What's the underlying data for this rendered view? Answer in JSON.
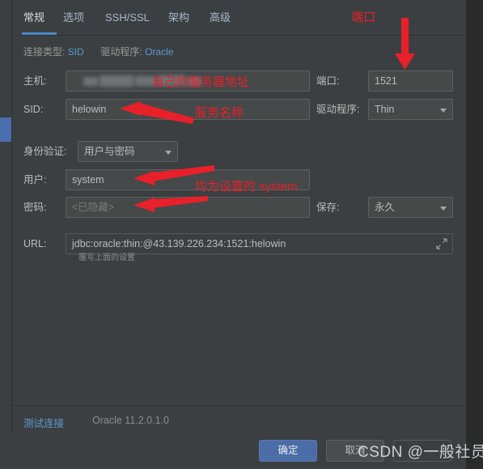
{
  "window": {
    "tabs": [
      {
        "label": "常规",
        "active": true
      },
      {
        "label": "选项",
        "active": false
      },
      {
        "label": "SSH/SSL",
        "active": false
      },
      {
        "label": "架构",
        "active": false
      },
      {
        "label": "高级",
        "active": false
      }
    ]
  },
  "summary": {
    "conn_type_label": "连接类型:",
    "conn_type_value": "SID",
    "driver_label": "驱动程序:",
    "driver_value": "Oracle"
  },
  "form": {
    "host": {
      "label": "主机:",
      "value": "",
      "censored": true
    },
    "port": {
      "label": "端口:",
      "value": "1521"
    },
    "sid": {
      "label": "SID:",
      "value": "helowin"
    },
    "driver": {
      "label": "驱动程序:",
      "value": "Thin"
    },
    "auth": {
      "label": "身份验证:",
      "value": "用户与密码"
    },
    "user": {
      "label": "用户:",
      "value": "system"
    },
    "password": {
      "label": "密码:",
      "placeholder": "<已隐藏>",
      "value": ""
    },
    "save": {
      "label": "保存:",
      "value": "永久"
    },
    "url": {
      "label": "URL:",
      "value": "jdbc:oracle:thin:@43.139.226.234:1521:helowin",
      "hint": "覆写上面的设置"
    }
  },
  "annotations": {
    "port_top": "端口",
    "host": "自己的服务器地址",
    "sid": "服务名称",
    "user": "均为设置的 system"
  },
  "footer": {
    "test_connection": "测试连接",
    "db_version": "Oracle 11.2.0.1.0"
  },
  "buttons": {
    "ok": "确定",
    "cancel": "取消",
    "third": ""
  },
  "watermark": "CSDN @一般社员",
  "colors": {
    "accent": "#4a88c7",
    "link": "#5b9bd5",
    "annotation": "#e8202a",
    "panel_bg": "#3c3f41",
    "field_bg": "#45494a",
    "primary_button": "#4a6da7"
  }
}
